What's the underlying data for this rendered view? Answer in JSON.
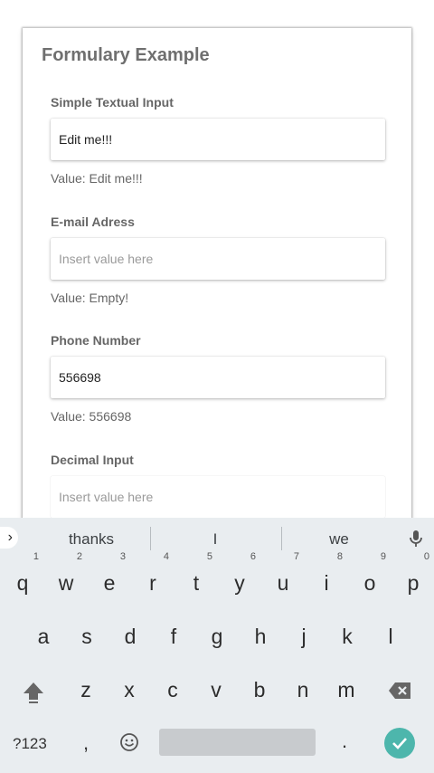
{
  "form": {
    "title": "Formulary Example",
    "fields": [
      {
        "label": "Simple Textual Input",
        "value": "Edit me!!!",
        "placeholder": "",
        "value_text": "Value: Edit me!!!"
      },
      {
        "label": "E-mail Adress",
        "value": "",
        "placeholder": "Insert value here",
        "value_text": "Value: Empty!"
      },
      {
        "label": "Phone Number",
        "value": "556698",
        "placeholder": "",
        "value_text": "Value: 556698"
      },
      {
        "label": "Decimal Input",
        "value": "",
        "placeholder": "Insert value here",
        "value_text": ""
      }
    ]
  },
  "keyboard": {
    "suggestions": [
      "thanks",
      "I",
      "we"
    ],
    "row1": [
      "q",
      "w",
      "e",
      "r",
      "t",
      "y",
      "u",
      "i",
      "o",
      "p"
    ],
    "row1_hints": [
      "1",
      "2",
      "3",
      "4",
      "5",
      "6",
      "7",
      "8",
      "9",
      "0"
    ],
    "row2": [
      "a",
      "s",
      "d",
      "f",
      "g",
      "h",
      "j",
      "k",
      "l"
    ],
    "row3": [
      "z",
      "x",
      "c",
      "v",
      "b",
      "n",
      "m"
    ],
    "symbols_label": "?123",
    "comma_label": ",",
    "period_label": ".",
    "icons": {
      "expand": "chevron-right-icon",
      "mic": "mic-icon",
      "shift": "shift-icon",
      "backspace": "backspace-icon",
      "emoji": "emoji-icon",
      "enter": "check-icon"
    },
    "colors": {
      "background": "#e9edf0",
      "enter": "#4db6ac",
      "spacebar": "#c8cbce"
    }
  }
}
